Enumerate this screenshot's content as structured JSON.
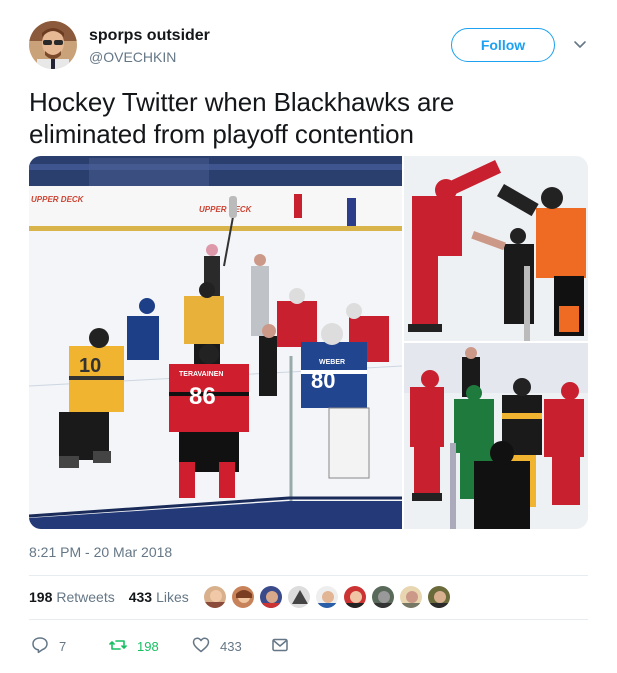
{
  "user": {
    "name": "sporps outsider",
    "handle": "@OVECHKIN"
  },
  "follow_label": "Follow",
  "tweet": {
    "text_line1": "Hockey Twitter when Blackhawks are",
    "text_line2": "eliminated from playoff contention",
    "timestamp": "8:21 PM - 20 Mar 2018"
  },
  "media": {
    "main_signage": "UPPER DECK",
    "main_jersey_numbers": [
      "10",
      "86",
      "80"
    ],
    "main_player_names": [
      "TERAVAINEN",
      "WEBER"
    ]
  },
  "stats": {
    "retweets_count": "198",
    "retweets_label": "Retweets",
    "likes_count": "433",
    "likes_label": "Likes"
  },
  "actions": {
    "reply_count": "7",
    "retweet_count": "198",
    "like_count": "433"
  },
  "colors": {
    "accent": "#1da1f2",
    "retweet_green": "#17bf63",
    "muted": "#657786",
    "text": "#14171a"
  },
  "icons": [
    "chevron-down-icon",
    "reply-icon",
    "retweet-icon",
    "heart-icon",
    "message-icon"
  ]
}
